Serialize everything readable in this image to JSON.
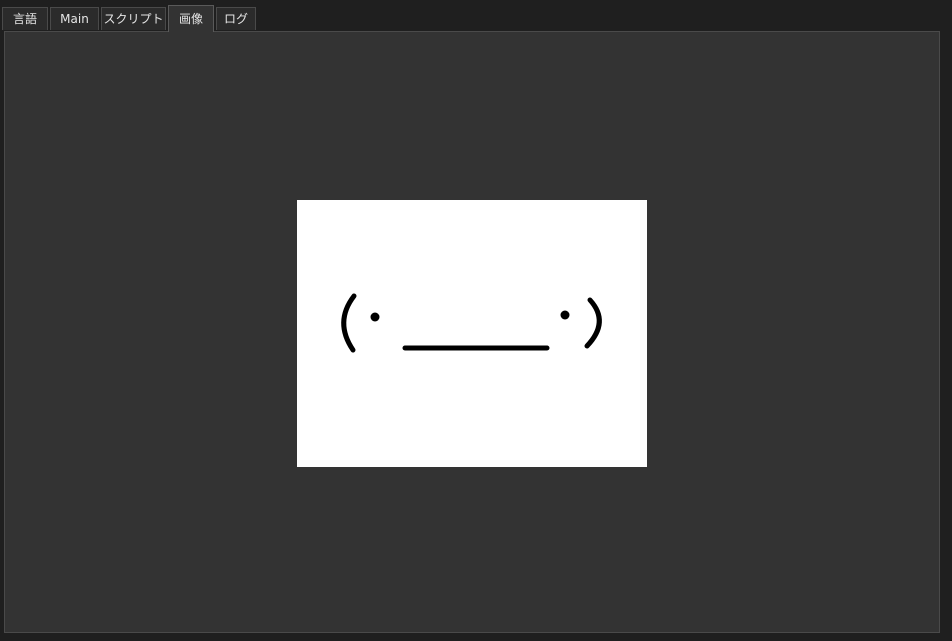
{
  "tabs": [
    {
      "label": "言語"
    },
    {
      "label": "Main"
    },
    {
      "label": "スクリプト"
    },
    {
      "label": "画像",
      "selected": true
    },
    {
      "label": "ログ"
    }
  ],
  "image_view": {
    "content_icon": "emoticon-face-icon",
    "background": "#ffffff",
    "stroke": "#000000"
  },
  "colors": {
    "window_bg": "#1f1f1f",
    "panel_bg": "#333333",
    "tab_bg": "#2b2b2b",
    "tab_text": "#e6e6e6"
  }
}
